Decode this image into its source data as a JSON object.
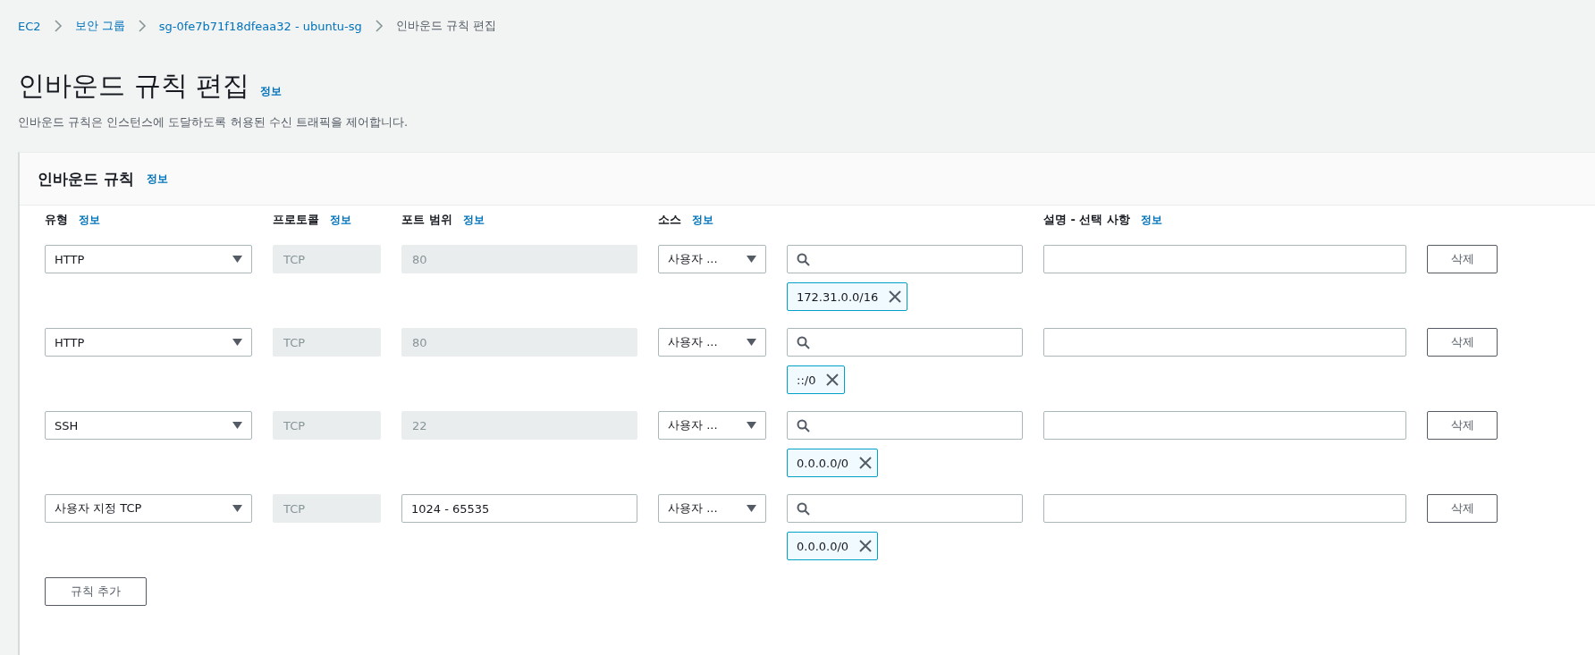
{
  "breadcrumbs": [
    {
      "label": "EC2",
      "link": true
    },
    {
      "label": "보안 그룹",
      "link": true
    },
    {
      "label": "sg-0fe7b71f18dfeaa32 - ubuntu-sg",
      "link": true
    },
    {
      "label": "인바운드 규칙 편집",
      "link": false
    }
  ],
  "page": {
    "title": "인바운드 규칙 편집",
    "info": "정보",
    "description": "인바운드 규칙은 인스턴스에 도달하도록 허용된 수신 트래픽을 제어합니다."
  },
  "panel": {
    "title": "인바운드 규칙",
    "info": "정보",
    "columns": [
      {
        "label": "유형",
        "info": "정보"
      },
      {
        "label": "프로토콜",
        "info": "정보"
      },
      {
        "label": "포트 범위",
        "info": "정보"
      },
      {
        "label": "소스",
        "info": "정보"
      },
      {
        "label": "설명 - 선택 사항",
        "info": "정보"
      }
    ],
    "rules": [
      {
        "type": "HTTP",
        "protocol": "TCP",
        "port": "80",
        "port_disabled": true,
        "source": "사용자 ...",
        "cidr": "172.31.0.0/16",
        "delete": "삭제"
      },
      {
        "type": "HTTP",
        "protocol": "TCP",
        "port": "80",
        "port_disabled": true,
        "source": "사용자 ...",
        "cidr": "::/0",
        "delete": "삭제"
      },
      {
        "type": "SSH",
        "protocol": "TCP",
        "port": "22",
        "port_disabled": true,
        "source": "사용자 ...",
        "cidr": "0.0.0.0/0",
        "delete": "삭제"
      },
      {
        "type": "사용자 지정 TCP",
        "protocol": "TCP",
        "port": "1024 - 65535",
        "port_disabled": false,
        "source": "사용자 ...",
        "cidr": "0.0.0.0/0",
        "delete": "삭제"
      }
    ],
    "add_button": "규칙 추가"
  }
}
